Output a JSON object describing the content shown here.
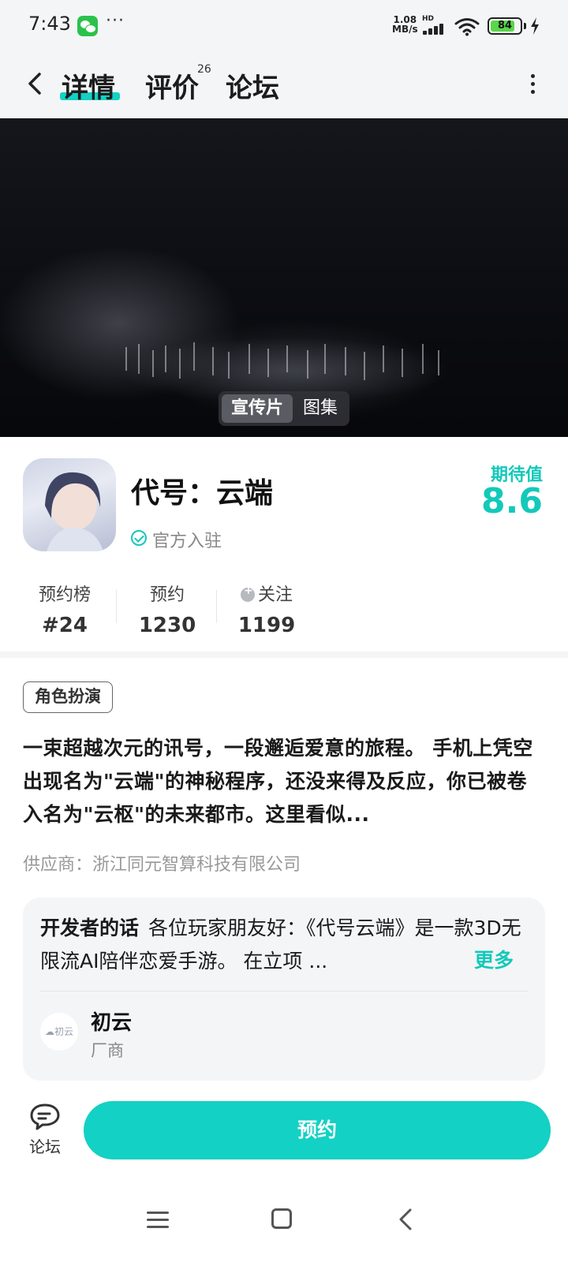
{
  "status_bar": {
    "time": "7:43",
    "dots": "···",
    "net_speed_value": "1.08",
    "net_speed_unit": "MB/s",
    "hd": "HD",
    "battery": "84",
    "battery_level": 0.84,
    "icons": [
      "wechat-icon",
      "signal-icon",
      "wifi-icon",
      "battery-icon",
      "bolt-icon"
    ]
  },
  "header": {
    "tabs": [
      {
        "label": "详情",
        "active": true
      },
      {
        "label": "评价",
        "count": "26"
      },
      {
        "label": "论坛"
      }
    ],
    "icons": [
      "back-icon",
      "more-icon"
    ]
  },
  "media": {
    "tabs": [
      {
        "label": "宣传片",
        "active": true
      },
      {
        "label": "图集"
      }
    ]
  },
  "game": {
    "title": "代号：云端",
    "verified": "官方入驻",
    "expect_label": "期待值",
    "expect_score": "8.6",
    "stats": [
      {
        "label": "预约榜",
        "value": "#24"
      },
      {
        "label": "预约",
        "value": "1230"
      },
      {
        "label": "关注",
        "value": "1199"
      }
    ],
    "tag": "角色扮演",
    "description": "一束超越次元的讯号，一段邂逅爱意的旅程。 手机上凭空出现名为\"云端\"的神秘程序，还没来得及反应，你已被卷入名为\"云枢\"的未来都市。这里看似...",
    "supplier": "供应商：浙江同元智算科技有限公司"
  },
  "developer": {
    "heading": "开发者的话",
    "text": "各位玩家朋友好：《代号云端》是一款3D无限流AI陪伴恋爱手游。 在立项 ...",
    "more": "更多",
    "avatar_text": "初云",
    "name": "初云",
    "role": "厂商"
  },
  "bottom": {
    "forum_label": "论坛",
    "reserve_label": "预约"
  },
  "colors": {
    "accent": "#13d1c4",
    "accent_text": "#13c9b9",
    "background_gray": "#f4f5f7"
  }
}
